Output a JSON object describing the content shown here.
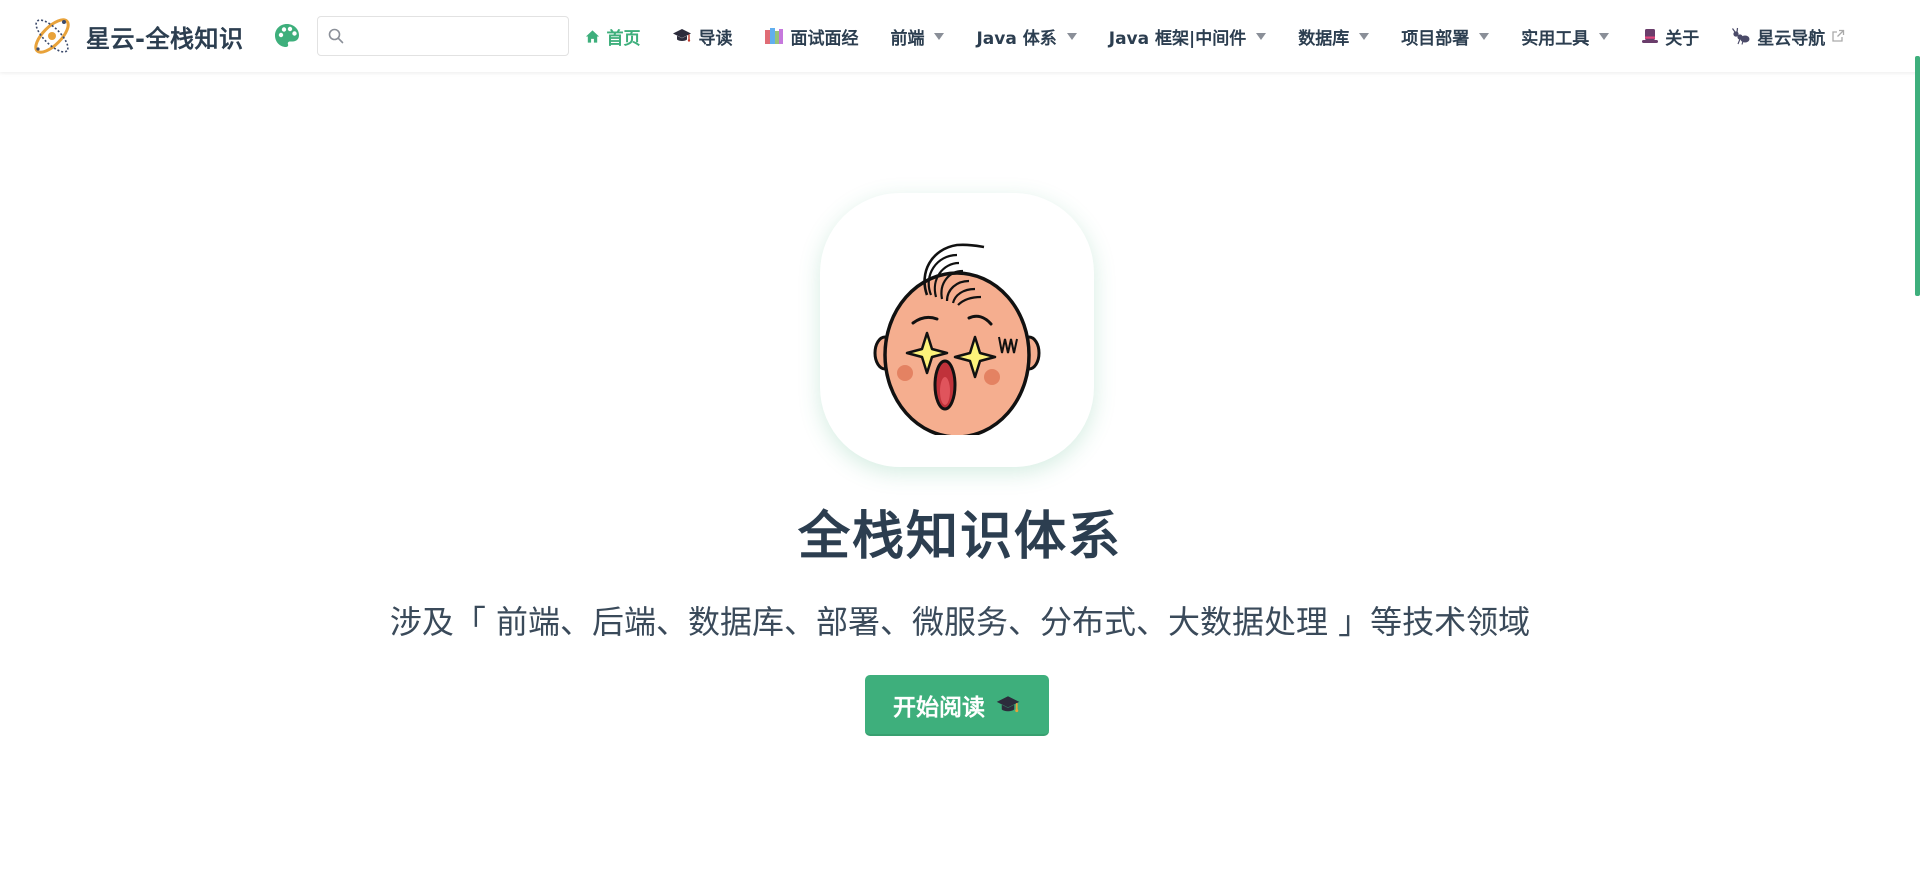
{
  "brand": {
    "title": "星云-全栈知识"
  },
  "search": {
    "value": "",
    "placeholder": ""
  },
  "nav": {
    "items": [
      {
        "label": "首页",
        "icon": "home-icon",
        "active": true
      },
      {
        "label": "导读",
        "icon": "graduation-cap-icon"
      },
      {
        "label": "面试面经",
        "icon": "books-icon"
      },
      {
        "label": "前端",
        "dropdown": true
      },
      {
        "label": "Java 体系",
        "dropdown": true
      },
      {
        "label": "Java 框架|中间件",
        "dropdown": true
      },
      {
        "label": "数据库",
        "dropdown": true
      },
      {
        "label": "项目部署",
        "dropdown": true
      },
      {
        "label": "实用工具",
        "dropdown": true
      },
      {
        "label": "关于",
        "icon": "top-hat-icon"
      },
      {
        "label": "星云导航",
        "icon": "ant-icon",
        "external": true
      }
    ]
  },
  "hero": {
    "image_icon": "cartoon-face-starry-eyes-icon",
    "title": "全栈知识体系",
    "description": "涉及「 前端、后端、数据库、部署、微服务、分布式、大数据处理 」等技术领域",
    "action_label": "开始阅读"
  },
  "colors": {
    "accent": "#3eaf7c",
    "text": "#2c3e50"
  }
}
